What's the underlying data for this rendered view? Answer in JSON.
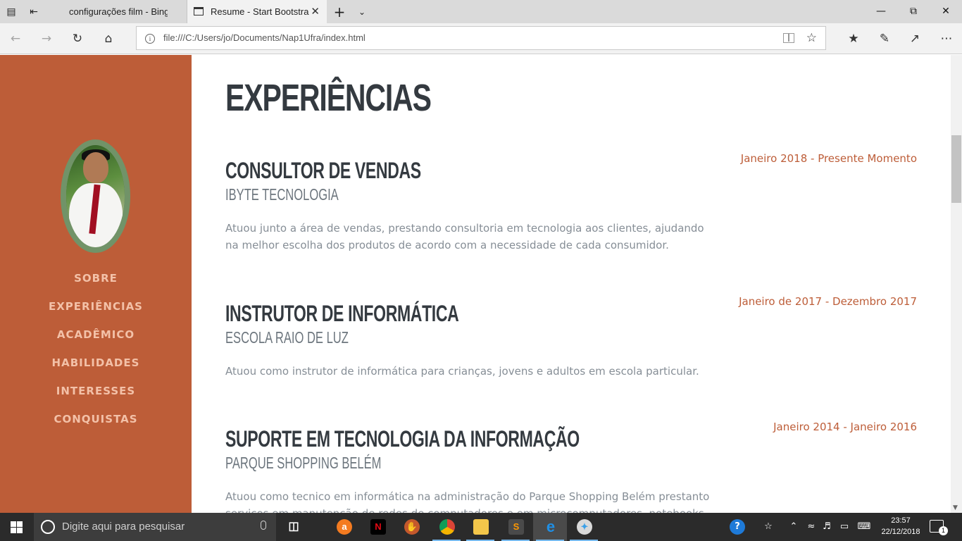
{
  "browser": {
    "tabs": [
      {
        "title": "configurações film - Bing",
        "active": false
      },
      {
        "title": "Resume - Start Bootstra",
        "active": true
      }
    ],
    "address": "file:///C:/Users/jo/Documents/Nap1Ufra/index.html",
    "icons": {
      "tab_preview": "tab-preview-icon",
      "set_aside": "set-aside-tabs-icon",
      "new_tab": "plus-icon",
      "tab_list": "chevron-down-icon",
      "back": "back-arrow-icon",
      "forward": "forward-arrow-icon",
      "refresh": "refresh-icon",
      "home": "home-icon",
      "reading_view": "reading-view-icon",
      "favorite": "star-icon",
      "favorites_hub": "favorites-icon",
      "notes": "pen-icon",
      "share": "share-icon",
      "more": "more-icon"
    }
  },
  "sidebar": {
    "color": "#bd5d38",
    "nav": [
      "SOBRE",
      "EXPERIÊNCIAS",
      "ACADÊMICO",
      "HABILIDADES",
      "INTERESSES",
      "CONQUISTAS"
    ]
  },
  "main": {
    "section_title": "EXPERIÊNCIAS",
    "experiences": [
      {
        "job": "CONSULTOR DE VENDAS",
        "company": "IBYTE TECNOLOGIA",
        "description": "Atuou junto a área de vendas, prestando consultoria em tecnologia aos clientes, ajudando na melhor escolha dos produtos de acordo com a necessidade de cada consumidor.",
        "date": "Janeiro 2018 - Presente Momento"
      },
      {
        "job": "INSTRUTOR DE INFORMÁTICA",
        "company": "ESCOLA RAIO DE LUZ",
        "description": "Atuou como instrutor de informática para crianças, jovens e adultos em escola particular.",
        "date": "Janeiro de 2017 - Dezembro 2017"
      },
      {
        "job": "SUPORTE EM TECNOLOGIA DA INFORMAÇÃO",
        "company": "PARQUE SHOPPING BELÉM",
        "description": "Atuou como tecnico em informática na administração do Parque Shopping Belém prestanto serviços em manutenção de redes de computadores e em microcomputadores, notebooks",
        "date": "Janeiro 2014 - Janeiro 2016"
      }
    ]
  },
  "taskbar": {
    "search_placeholder": "Digite aqui para pesquisar",
    "time": "23:57",
    "date": "22/12/2018",
    "notification_count": "1",
    "apps": [
      "avast-icon",
      "netflix-icon",
      "baseball-glove-icon",
      "chrome-icon",
      "file-explorer-icon",
      "sublime-text-icon",
      "edge-icon",
      "paint-icon"
    ]
  }
}
